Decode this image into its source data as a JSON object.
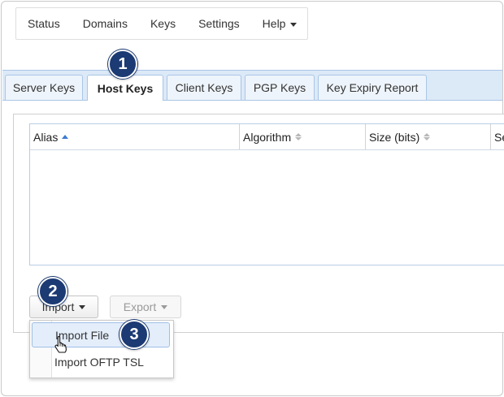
{
  "topnav": {
    "items": [
      "Status",
      "Domains",
      "Keys",
      "Settings",
      "Help"
    ]
  },
  "tabs": [
    {
      "label": "Server Keys",
      "active": false
    },
    {
      "label": "Host Keys",
      "active": true
    },
    {
      "label": "Client Keys",
      "active": false
    },
    {
      "label": "PGP Keys",
      "active": false
    },
    {
      "label": "Key Expiry Report",
      "active": false
    }
  ],
  "table": {
    "columns": [
      {
        "label": "Alias",
        "sort": "asc"
      },
      {
        "label": "Algorithm",
        "sort": "none"
      },
      {
        "label": "Size (bits)",
        "sort": "none"
      },
      {
        "label": "Se",
        "sort": "none"
      }
    ],
    "rows": []
  },
  "buttons": {
    "import": "Import",
    "export": "Export"
  },
  "import_menu": {
    "items": [
      "Import File",
      "Import OFTP TSL"
    ]
  },
  "callouts": [
    "1",
    "2",
    "3"
  ],
  "colors": {
    "tab_strip": "#dce9f7",
    "callout": "#1c3a73",
    "sort_active": "#3b7bd0",
    "menu_hover": "#e4eefb"
  },
  "icons": {
    "help_caret": "chevron-down-icon",
    "cursor": "hand-pointer-icon"
  }
}
